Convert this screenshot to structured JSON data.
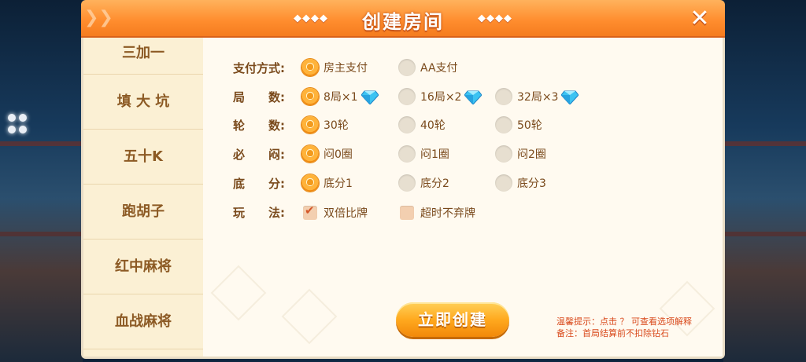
{
  "dialog": {
    "title": "创建房间",
    "title_deco_left": "◆◆◆◆",
    "title_deco_right": "◆◆◆◆",
    "close_icon": "close-icon"
  },
  "sidebar": {
    "items": [
      {
        "label": "三加一"
      },
      {
        "label": "填 大 坑"
      },
      {
        "label": "五十K"
      },
      {
        "label": "跑胡子"
      },
      {
        "label": "红中麻将"
      },
      {
        "label": "血战麻将"
      }
    ]
  },
  "settings": {
    "payment": {
      "label": "支付方式:",
      "options": [
        {
          "text": "房主支付",
          "selected": true
        },
        {
          "text": "AA支付",
          "selected": false
        }
      ]
    },
    "rounds": {
      "label": "局　　数:",
      "options": [
        {
          "text": "8局×1",
          "selected": true,
          "icon": "diamond-icon"
        },
        {
          "text": "16局×2",
          "selected": false,
          "icon": "diamond-icon"
        },
        {
          "text": "32局×3",
          "selected": false,
          "icon": "diamond-icon"
        }
      ]
    },
    "turns": {
      "label": "轮　　数:",
      "options": [
        {
          "text": "30轮",
          "selected": true
        },
        {
          "text": "40轮",
          "selected": false
        },
        {
          "text": "50轮",
          "selected": false
        }
      ]
    },
    "must_stuffy": {
      "label": "必　　闷:",
      "options": [
        {
          "text": "闷0圈",
          "selected": true
        },
        {
          "text": "闷1圈",
          "selected": false
        },
        {
          "text": "闷2圈",
          "selected": false
        }
      ]
    },
    "base_score": {
      "label": "底　　分:",
      "options": [
        {
          "text": "底分1",
          "selected": true
        },
        {
          "text": "底分2",
          "selected": false
        },
        {
          "text": "底分3",
          "selected": false
        }
      ]
    },
    "gameplay": {
      "label": "玩　　法:",
      "options": [
        {
          "text": "双倍比牌",
          "checked": true
        },
        {
          "text": "超时不弃牌",
          "checked": false
        }
      ]
    }
  },
  "create_button": {
    "label": "立即创建"
  },
  "tips": {
    "line1": "温馨提示：点击 ？ 可查看选项解释",
    "line2": "备注：首局结算前不扣除钻石"
  },
  "colors": {
    "header": "#ff8d2e",
    "panel_bg": "#fff6e6",
    "text_brown": "#7a4a1c",
    "tip_red": "#d94a1c"
  }
}
